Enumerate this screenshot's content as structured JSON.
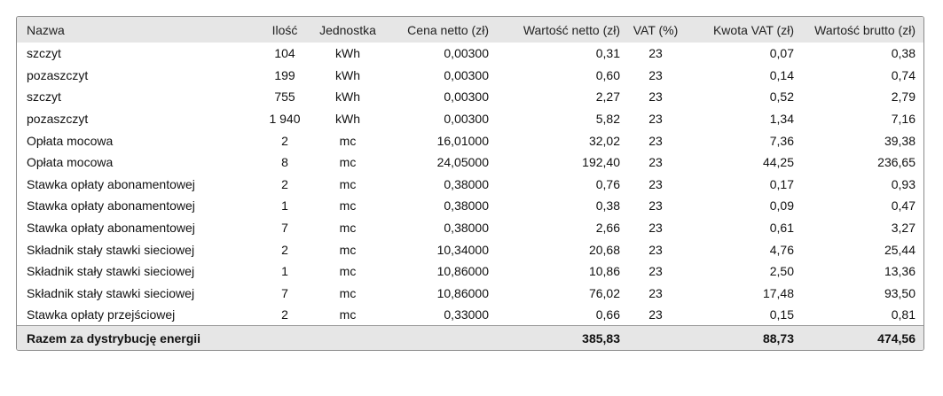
{
  "table": {
    "headers": [
      "Nazwa",
      "Ilość",
      "Jednostka",
      "Cena netto (zł)",
      "Wartość netto (zł)",
      "VAT (%)",
      "Kwota VAT (zł)",
      "Wartość brutto (zł)"
    ],
    "rows": [
      [
        "szczyt",
        "104",
        "kWh",
        "0,00300",
        "0,31",
        "23",
        "0,07",
        "0,38"
      ],
      [
        "pozaszczyt",
        "199",
        "kWh",
        "0,00300",
        "0,60",
        "23",
        "0,14",
        "0,74"
      ],
      [
        "szczyt",
        "755",
        "kWh",
        "0,00300",
        "2,27",
        "23",
        "0,52",
        "2,79"
      ],
      [
        "pozaszczyt",
        "1 940",
        "kWh",
        "0,00300",
        "5,82",
        "23",
        "1,34",
        "7,16"
      ],
      [
        "Opłata mocowa",
        "2",
        "mc",
        "16,01000",
        "32,02",
        "23",
        "7,36",
        "39,38"
      ],
      [
        "Opłata mocowa",
        "8",
        "mc",
        "24,05000",
        "192,40",
        "23",
        "44,25",
        "236,65"
      ],
      [
        "Stawka opłaty abonamentowej",
        "2",
        "mc",
        "0,38000",
        "0,76",
        "23",
        "0,17",
        "0,93"
      ],
      [
        "Stawka opłaty abonamentowej",
        "1",
        "mc",
        "0,38000",
        "0,38",
        "23",
        "0,09",
        "0,47"
      ],
      [
        "Stawka opłaty abonamentowej",
        "7",
        "mc",
        "0,38000",
        "2,66",
        "23",
        "0,61",
        "3,27"
      ],
      [
        "Składnik stały stawki sieciowej",
        "2",
        "mc",
        "10,34000",
        "20,68",
        "23",
        "4,76",
        "25,44"
      ],
      [
        "Składnik stały stawki sieciowej",
        "1",
        "mc",
        "10,86000",
        "10,86",
        "23",
        "2,50",
        "13,36"
      ],
      [
        "Składnik stały stawki sieciowej",
        "7",
        "mc",
        "10,86000",
        "76,02",
        "23",
        "17,48",
        "93,50"
      ],
      [
        "Stawka opłaty przejściowej",
        "2",
        "mc",
        "0,33000",
        "0,66",
        "23",
        "0,15",
        "0,81"
      ]
    ],
    "total": {
      "label": "Razem za dystrybucję energii",
      "net_value": "385,83",
      "vat_amount": "88,73",
      "gross_value": "474,56"
    }
  }
}
